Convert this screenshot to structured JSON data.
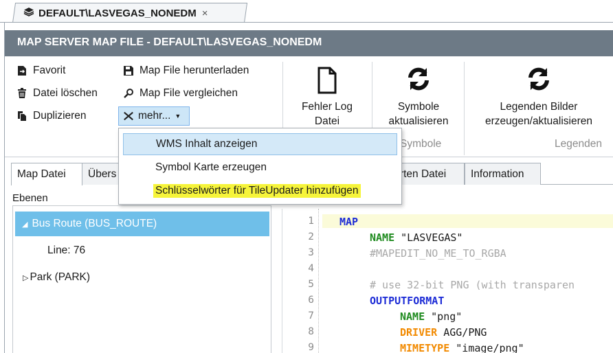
{
  "doc_tab": {
    "title": "DEFAULT\\LASVEGAS_NONEDM",
    "close": "×"
  },
  "panel_title": "MAP SERVER MAP FILE - DEFAULT\\LASVEGAS_NONEDM",
  "ribbon": {
    "favorit": "Favorit",
    "datei_loeschen": "Datei löschen",
    "duplizieren": "Duplizieren",
    "download": "Map File herunterladen",
    "vergleichen": "Map File vergleichen",
    "mehr": "mehr...",
    "fehler_log": [
      "Fehler Log",
      "Datei"
    ],
    "symbole": [
      "Symbole",
      "aktualisieren"
    ],
    "legenden": [
      "Legenden Bilder",
      "erzeugen/aktualisieren"
    ],
    "group_symbole": "Symbole",
    "group_legenden": "Legenden"
  },
  "menu": {
    "items": [
      {
        "label": "WMS Inhalt anzeigen"
      },
      {
        "label": "Symbol Karte erzeugen"
      },
      {
        "label": "Schlüsselwörter für TileUpdater hinzufügen"
      }
    ]
  },
  "tabs": {
    "map_datei": "Map Datei",
    "uebers": "Übers",
    "karten_datei": "Karten Datei",
    "information": "Information"
  },
  "layers": {
    "label": "Ebenen",
    "selected": "Bus Route (BUS_ROUTE)",
    "child": "Line: 76",
    "park": "Park (PARK)"
  },
  "code": {
    "line_numbers": [
      "1",
      "2",
      "3",
      "4",
      "5",
      "6",
      "7",
      "8",
      "9"
    ],
    "l1": "MAP",
    "l2_key": "NAME",
    "l2_val": " \"LASVEGAS\"",
    "l3": "#MAPEDIT_NO_ME_TO_RGBA",
    "l5": "# use 32-bit PNG (with transparen",
    "l6": "OUTPUTFORMAT",
    "l7_key": "NAME",
    "l7_val": " \"png\"",
    "l8_key": "DRIVER",
    "l8_val": " AGG/PNG",
    "l9_key": "MIMETYPE",
    "l9_val": " \"image/png\""
  },
  "colors": {
    "titlebar": "#6d7a86",
    "selection": "#6fbfe9",
    "menu_hover": "#d4e9f8",
    "highlight": "#f6f43a",
    "keyword_blue": "#1c2bd6",
    "keyword_green": "#1e8a1e",
    "keyword_orange": "#f28a00"
  }
}
